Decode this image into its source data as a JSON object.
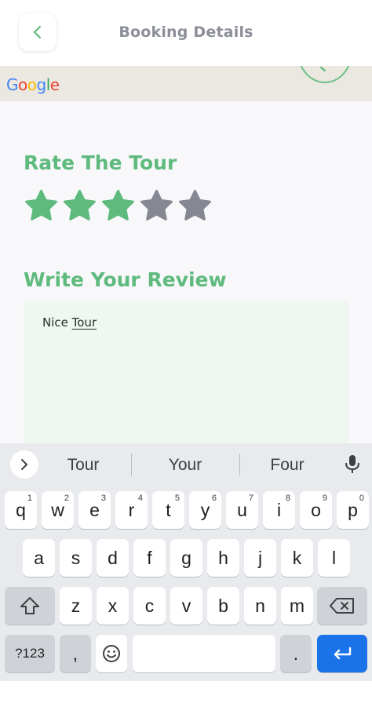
{
  "header": {
    "title": "Booking Details",
    "back_icon": "chevron-left-icon"
  },
  "map": {
    "logo": "Google"
  },
  "rating": {
    "title": "Rate The Tour",
    "value": 3,
    "max": 5,
    "filled_color": "#5fba7d",
    "empty_color": "#858892"
  },
  "review": {
    "title": "Write Your Review",
    "text_plain": "Nice ",
    "text_underlined": "Tour"
  },
  "keyboard": {
    "suggestions": [
      "Tour",
      "Your",
      "Four"
    ],
    "row1": [
      {
        "k": "q",
        "h": "1"
      },
      {
        "k": "w",
        "h": "2"
      },
      {
        "k": "e",
        "h": "3"
      },
      {
        "k": "r",
        "h": "4"
      },
      {
        "k": "t",
        "h": "5"
      },
      {
        "k": "y",
        "h": "6"
      },
      {
        "k": "u",
        "h": "7"
      },
      {
        "k": "i",
        "h": "8"
      },
      {
        "k": "o",
        "h": "9"
      },
      {
        "k": "p",
        "h": "0"
      }
    ],
    "row2": [
      "a",
      "s",
      "d",
      "f",
      "g",
      "h",
      "j",
      "k",
      "l"
    ],
    "row3": [
      "z",
      "x",
      "c",
      "v",
      "b",
      "n",
      "m"
    ],
    "symbols_label": "?123",
    "comma_label": ",",
    "period_label": ".",
    "enter_color": "#1a73e8"
  }
}
